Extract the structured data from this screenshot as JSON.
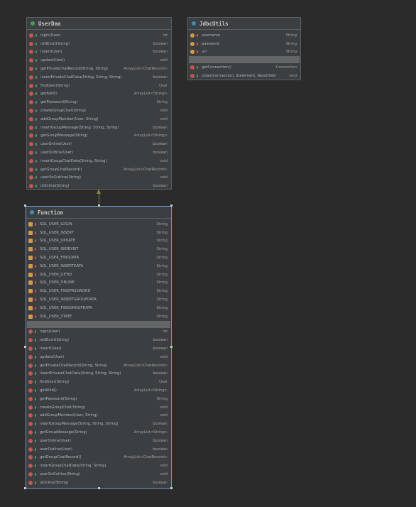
{
  "userdao": {
    "title": "UserDao",
    "members": [
      {
        "name": "login(User)",
        "type": "int"
      },
      {
        "name": "isIdExist(String)",
        "type": "boolean"
      },
      {
        "name": "insert(User)",
        "type": "boolean"
      },
      {
        "name": "update(User)",
        "type": "void"
      },
      {
        "name": "getPrivateChatRecord(String, String)",
        "type": "ArrayList<ChatRecord>"
      },
      {
        "name": "insertPrivateChatData(String, String, String)",
        "type": "boolean"
      },
      {
        "name": "findUser(String)",
        "type": "User"
      },
      {
        "name": "getAllId()",
        "type": "ArrayList<String>"
      },
      {
        "name": "getPassword(String)",
        "type": "String"
      },
      {
        "name": "createGroupChat(String)",
        "type": "void"
      },
      {
        "name": "addGroupMember(User, String)",
        "type": "void"
      },
      {
        "name": "insertGroupMessage(String, String, String)",
        "type": "boolean"
      },
      {
        "name": "getGroupMessage(String)",
        "type": "ArrayList<String>"
      },
      {
        "name": "userOnline(User)",
        "type": "boolean"
      },
      {
        "name": "userOutline(User)",
        "type": "boolean"
      },
      {
        "name": "insertGroupChatData(String, String)",
        "type": "void"
      },
      {
        "name": "getGroupChatRecord()",
        "type": "ArrayList<ChatRecord>"
      },
      {
        "name": "userOnOutline(String)",
        "type": "void"
      },
      {
        "name": "isOnline(String)",
        "type": "boolean"
      }
    ]
  },
  "jdbcutils": {
    "title": "JdbcUtils",
    "fields": [
      {
        "name": "username",
        "type": "String"
      },
      {
        "name": "password",
        "type": "String"
      },
      {
        "name": "url",
        "type": "String"
      }
    ],
    "methods": [
      {
        "name": "getConnection()",
        "type": "Connection"
      },
      {
        "name": "close(Connection, Statement, ResultSet)",
        "type": "void"
      }
    ]
  },
  "function": {
    "title": "Function",
    "fields": [
      {
        "name": "SQL_USER_LOGIN",
        "type": "String"
      },
      {
        "name": "SQL_USER_INSERT",
        "type": "String"
      },
      {
        "name": "SQL_USER_UPDATE",
        "type": "String"
      },
      {
        "name": "SQL_USER_ISIDEXIST",
        "type": "String"
      },
      {
        "name": "SQL_USER_FINDDATA",
        "type": "String"
      },
      {
        "name": "SQL_USER_INSERTDATA",
        "type": "String"
      },
      {
        "name": "SQL_USER_GETID",
        "type": "String"
      },
      {
        "name": "SQL_USER_ONLINE",
        "type": "String"
      },
      {
        "name": "SQL_USER_FINDPASSWORD",
        "type": "String"
      },
      {
        "name": "SQL_USER_INSERTGROUPDATA",
        "type": "String"
      },
      {
        "name": "SQL_USER_FINDGROUPDATA",
        "type": "String"
      },
      {
        "name": "SQL_USER_STATE",
        "type": "String"
      }
    ],
    "methods": [
      {
        "name": "login(User)",
        "type": "int"
      },
      {
        "name": "isIdExist(String)",
        "type": "boolean"
      },
      {
        "name": "insert(User)",
        "type": "boolean"
      },
      {
        "name": "update(User)",
        "type": "void"
      },
      {
        "name": "getPrivateChatRecord(String, String)",
        "type": "ArrayList<ChatRecord>"
      },
      {
        "name": "insertPrivateChatData(String, String, String)",
        "type": "boolean"
      },
      {
        "name": "findUser(String)",
        "type": "User"
      },
      {
        "name": "getAllId()",
        "type": "ArrayList<String>"
      },
      {
        "name": "getPassword(String)",
        "type": "String"
      },
      {
        "name": "createGroupChat(String)",
        "type": "void"
      },
      {
        "name": "addGroupMember(User, String)",
        "type": "void"
      },
      {
        "name": "insertGroupMessage(String, String, String)",
        "type": "boolean"
      },
      {
        "name": "getGroupMessage(String)",
        "type": "ArrayList<String>"
      },
      {
        "name": "userOnline(User)",
        "type": "boolean"
      },
      {
        "name": "userOutline(User)",
        "type": "boolean"
      },
      {
        "name": "getGroupChatRecord()",
        "type": "ArrayList<ChatRecord>"
      },
      {
        "name": "insertGroupChatData(String, String)",
        "type": "void"
      },
      {
        "name": "userOnOutline(String)",
        "type": "void"
      },
      {
        "name": "isOnline(String)",
        "type": "boolean"
      }
    ]
  },
  "colors": {
    "interface_icon": "#4b9a5a",
    "class_icon": "#3b8eb5",
    "method_icon": "#c75450",
    "field_icon": "#d19a44",
    "inheritance_arrow": "#7a8a3a",
    "selection_border": "#6f9ad3"
  }
}
